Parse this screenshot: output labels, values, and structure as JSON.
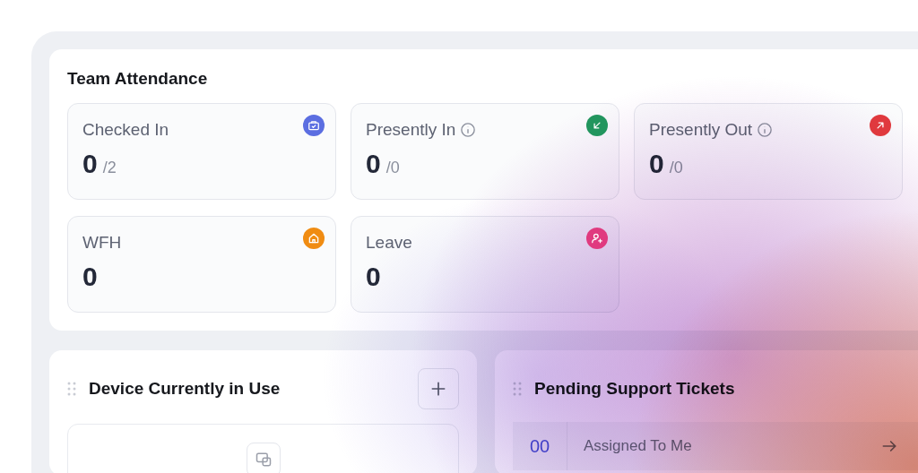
{
  "attendance": {
    "title": "Team Attendance",
    "stats": [
      {
        "label": "Checked In",
        "value": "0",
        "total": "/2",
        "info": false,
        "kind": "briefcase",
        "color": "#5b6ee1"
      },
      {
        "label": "Presently In",
        "value": "0",
        "total": "/0",
        "info": true,
        "kind": "arrow-in",
        "color": "#22955e"
      },
      {
        "label": "Presently Out",
        "value": "0",
        "total": "/0",
        "info": true,
        "kind": "arrow-out",
        "color": "#e0393e"
      },
      {
        "label": "WFH",
        "value": "0",
        "info": false,
        "kind": "home",
        "color": "#f08c12"
      },
      {
        "label": "Leave",
        "value": "0",
        "info": false,
        "kind": "user-add",
        "color": "#e03a7f"
      }
    ]
  },
  "devices": {
    "title": "Device Currently in Use"
  },
  "tickets": {
    "title": "Pending Support Tickets",
    "rows": [
      {
        "count": "00",
        "label": "Assigned To Me"
      }
    ]
  }
}
